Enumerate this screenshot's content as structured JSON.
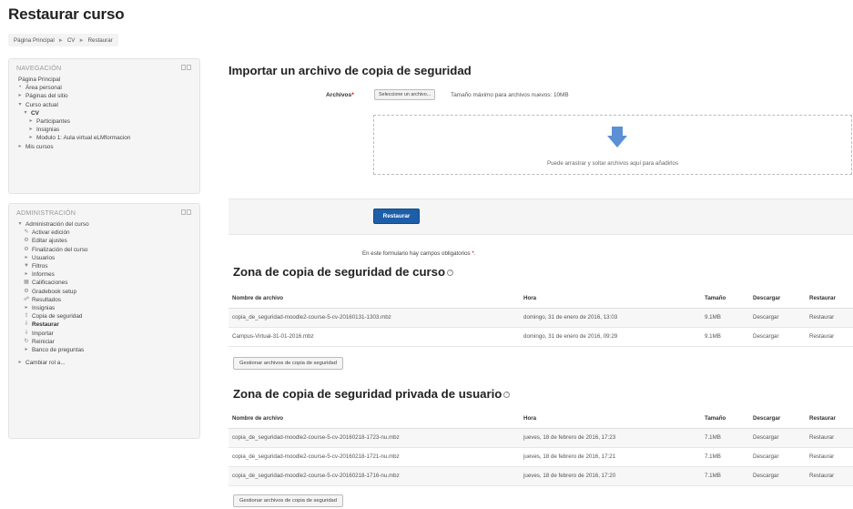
{
  "page": {
    "title": "Restaurar curso"
  },
  "breadcrumb": {
    "items": [
      "Página Principal",
      "CV",
      "Restaurar"
    ],
    "separator": "►"
  },
  "navigation": {
    "title": "NAVEGACIÓN",
    "items": [
      {
        "label": "Página Principal",
        "marker": ""
      },
      {
        "label": "Área personal",
        "marker": "•"
      },
      {
        "label": "Páginas del sitio",
        "marker": "▸"
      },
      {
        "label": "Curso actual",
        "marker": "▾"
      },
      {
        "label": "CV",
        "marker": "▾"
      },
      {
        "label": "Participantes",
        "marker": "▸"
      },
      {
        "label": "Insignias",
        "marker": "▸"
      },
      {
        "label": "Modulo 1: Aula virtual eLMformacion",
        "marker": "▸"
      },
      {
        "label": "Mis cursos",
        "marker": "▸"
      }
    ]
  },
  "administration": {
    "title": "ADMINISTRACIÓN",
    "items": [
      {
        "label": "Administración del curso",
        "icon": "chevron-down-icon"
      },
      {
        "label": "Activar edición",
        "icon": "pencil-icon"
      },
      {
        "label": "Editar ajustes",
        "icon": "gear-icon"
      },
      {
        "label": "Finalización del curso",
        "icon": "gear-icon"
      },
      {
        "label": "Usuarios",
        "icon": "chevron-right-icon"
      },
      {
        "label": "Filtros",
        "icon": "filter-icon"
      },
      {
        "label": "Informes",
        "icon": "chevron-right-icon"
      },
      {
        "label": "Calificaciones",
        "icon": "grades-icon"
      },
      {
        "label": "Gradebook setup",
        "icon": "gear-icon"
      },
      {
        "label": "Resultados",
        "icon": "outcomes-icon"
      },
      {
        "label": "Insignias",
        "icon": "chevron-right-icon"
      },
      {
        "label": "Copia de seguridad",
        "icon": "backup-icon"
      },
      {
        "label": "Restaurar",
        "icon": "restore-icon"
      },
      {
        "label": "Importar",
        "icon": "import-icon"
      },
      {
        "label": "Reiniciar",
        "icon": "reset-icon"
      },
      {
        "label": "Banco de preguntas",
        "icon": "chevron-right-icon"
      },
      {
        "label": "Cambiar rol a...",
        "icon": "chevron-right-icon"
      }
    ]
  },
  "import_section": {
    "heading": "Importar un archivo de copia de seguridad",
    "files_label": "Archivos",
    "required_mark": "*",
    "choose_button": "Seleccione un archivo...",
    "max_size": "Tamaño máximo para archivos nuevos: 10MB",
    "dropzone_text": "Puede arrastrar y soltar archivos aquí para añadirlos",
    "submit_label": "Restaurar",
    "required_note": "En este formulario hay campos obligatorios",
    "required_note_mark": "*"
  },
  "course_backup": {
    "heading": "Zona de copia de seguridad de curso",
    "columns": [
      "Nombre de archivo",
      "Hora",
      "Tamaño",
      "Descargar",
      "Restaurar"
    ],
    "rows": [
      [
        "copia_de_seguridad-moodle2-course-5-cv-20160131-1303.mbz",
        "domingo, 31 de enero de 2016, 13:03",
        "9.1MB",
        "Descargar",
        "Restaurar"
      ],
      [
        "Campus-Virtual-31-01-2016.mbz",
        "domingo, 31 de enero de 2016, 09:29",
        "9.1MB",
        "Descargar",
        "Restaurar"
      ]
    ],
    "manage_button": "Gestionar archivos de copia de seguridad"
  },
  "user_backup": {
    "heading": "Zona de copia de seguridad privada de usuario",
    "columns": [
      "Nombre de archivo",
      "Hora",
      "Tamaño",
      "Descargar",
      "Restaurar"
    ],
    "rows": [
      [
        "copia_de_seguridad-moodle2-course-5-cv-20160218-1723-nu.mbz",
        "jueves, 18 de febrero de 2016, 17:23",
        "7.1MB",
        "Descargar",
        "Restaurar"
      ],
      [
        "copia_de_seguridad-moodle2-course-5-cv-20160218-1721-nu.mbz",
        "jueves, 18 de febrero de 2016, 17:21",
        "7.1MB",
        "Descargar",
        "Restaurar"
      ],
      [
        "copia_de_seguridad-moodle2-course-5-cv-20160218-1716-nu.mbz",
        "jueves, 18 de febrero de 2016, 17:20",
        "7.1MB",
        "Descargar",
        "Restaurar"
      ]
    ],
    "manage_button": "Gestionar archivos de copia de seguridad"
  },
  "colors": {
    "primary_button": "#1d5ea8",
    "drop_arrow": "#5b8fd6",
    "required": "#cc0000"
  }
}
